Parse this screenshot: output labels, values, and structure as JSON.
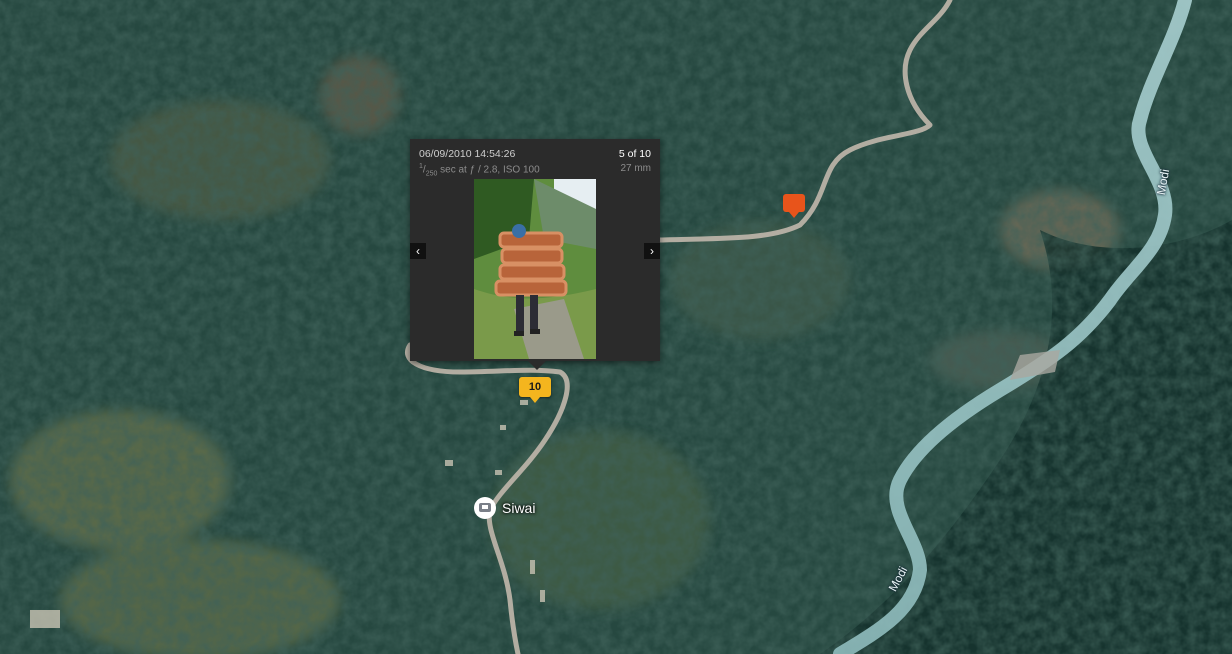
{
  "popup": {
    "datetime": "06/09/2010 14:54:26",
    "shutter_numerator": "1",
    "shutter_denominator": "250",
    "exif_rest": " sec at ƒ / 2.8, ISO 100",
    "counter": "5 of 10",
    "focal_length": "27 mm",
    "prev_icon": "‹",
    "next_icon": "›"
  },
  "markers": {
    "cluster_count": "10"
  },
  "places": {
    "village": "Siwai",
    "river_upper": "Modi",
    "river_lower": "Modi"
  },
  "colors": {
    "forest": "#1f3a33",
    "river": "#9fc7c8",
    "road": "#b9b2a6",
    "marker_orange": "#e8541b",
    "marker_yellow": "#f4b51e",
    "popup_bg": "#2b2b2b"
  }
}
